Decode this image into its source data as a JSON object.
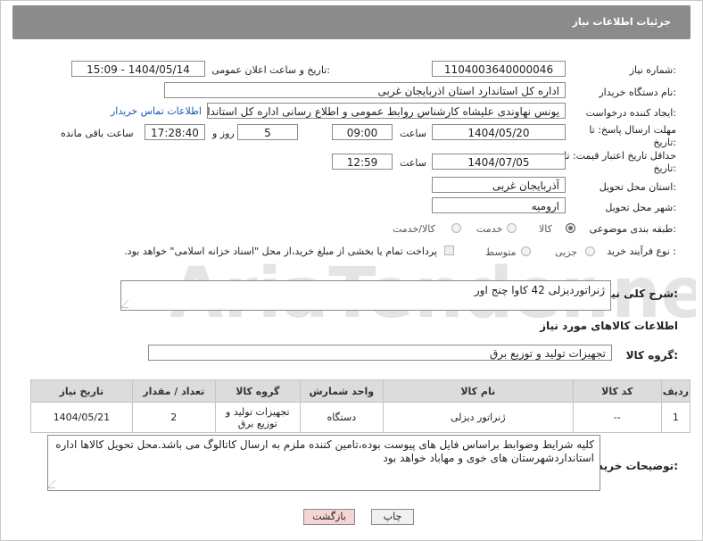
{
  "header": {
    "title": "جزئیات اطلاعات نیاز"
  },
  "fields": {
    "need_number_label": "شماره نیاز:",
    "need_number": "1104003640000046",
    "announce_label": "تاریخ و ساعت اعلان عمومی:",
    "announce_value": "1404/05/14 - 15:09",
    "buyer_label": "نام دستگاه خریدار:",
    "buyer_value": "اداره کل استاندارد استان اذربایجان غربی",
    "creator_label": "ایجاد کننده درخواست:",
    "creator_value": "یونس نهاوندی علیشاه کارشناس روابط عمومی و اطلاع رسانی اداره کل استاندارد",
    "contact_link": "اطلاعات تماس خریدار",
    "deadline_label": "مهلت ارسال پاسخ: تا تاریخ:",
    "deadline_date": "1404/05/20",
    "time_label": "ساعت",
    "deadline_time": "09:00",
    "days_value": "5",
    "days_label": "روز و",
    "remaining_time": "17:28:40",
    "remaining_label": "ساعت باقی مانده",
    "price_label": "حداقل تاریخ اعتبار قیمت: تا تاریخ:",
    "price_date": "1404/07/05",
    "price_time": "12:59",
    "province_label": "استان محل تحویل:",
    "province_value": "آذربایجان غربی",
    "city_label": "شهر محل تحویل:",
    "city_value": "ارومیه",
    "category_label": "طبقه بندی موضوعی:",
    "category_options": [
      "کالا",
      "خدمت",
      "کالا/خدمت"
    ],
    "process_label": "نوع فرآیند خرید :",
    "process_options": [
      "جزیی",
      "متوسط"
    ],
    "payment_note": "پرداخت تمام یا بخشی از مبلغ خرید،از محل \"اسناد خزانه اسلامی\" خواهد بود."
  },
  "description": {
    "label": "شرح کلی نیاز:",
    "value": "ژنراتوردیزلی 42 کاوا چنج اور"
  },
  "goods_section": {
    "title": "اطلاعات کالاهای مورد نیاز",
    "group_label": "گروه کالا:",
    "group_value": "تجهیزات تولید و توزیع برق"
  },
  "table": {
    "headers": [
      "ردیف",
      "کد کالا",
      "نام کالا",
      "واحد شمارش",
      "گروه کالا",
      "تعداد / مقدار",
      "تاریخ نیاز"
    ],
    "rows": [
      {
        "row": "1",
        "code": "--",
        "name": "ژنراتور دیزلی",
        "unit": "دستگاه",
        "group": "تجهیزات تولید و توزیع برق",
        "qty": "2",
        "date": "1404/05/21"
      }
    ]
  },
  "buyer_notes": {
    "label": "توضیحات خریدار:",
    "value": "کلیه شرایط وضوابط براساس فایل های پیوست بوده،تامین کننده ملزم به ارسال کاتالوگ می باشد.محل تحویل کالاها اداره استانداردشهرستان های خوی و مهاباد خواهد بود"
  },
  "buttons": {
    "print": "چاپ",
    "back": "بازگشت"
  },
  "watermark": "AriaTender.net",
  "colors": {
    "header_bg": "#8b8b8b",
    "link": "#1a57b0",
    "back_btn_bg": "#f6d4d4"
  }
}
